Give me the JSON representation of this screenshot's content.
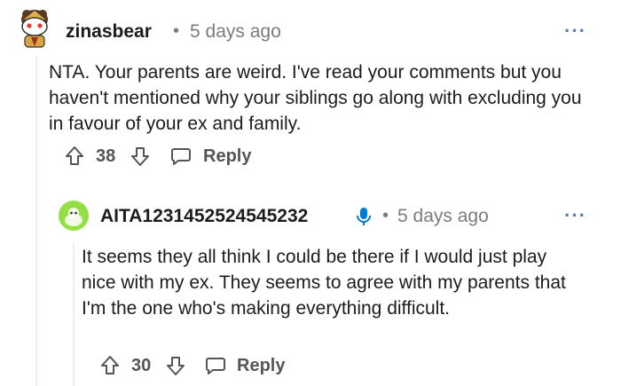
{
  "comment": {
    "username": "zinasbear",
    "separator": "•",
    "time": "5 days ago",
    "body": "NTA. Your parents are weird. I've read your comments but you haven't mentioned why your siblings go along with excluding you in favour of your ex and family.",
    "votes": "38",
    "reply_label": "Reply",
    "more_label": "···"
  },
  "reply": {
    "username": "AITA1231452524545232",
    "separator": "•",
    "time": "5 days ago",
    "body": "It seems they all think I could be there if I would just play nice with my ex. They seems to agree with my parents that I'm the one who's making everything difficult.",
    "votes": "30",
    "reply_label": "Reply",
    "more_label": "···"
  },
  "colors": {
    "op_badge": "#0079d3",
    "reply_avatar_bg": "#94e044",
    "muted": "#7c7c7c"
  },
  "icons": {
    "upvote": "upvote-icon",
    "downvote": "downvote-icon",
    "reply": "comment-bubble-icon",
    "op": "microphone-icon"
  }
}
